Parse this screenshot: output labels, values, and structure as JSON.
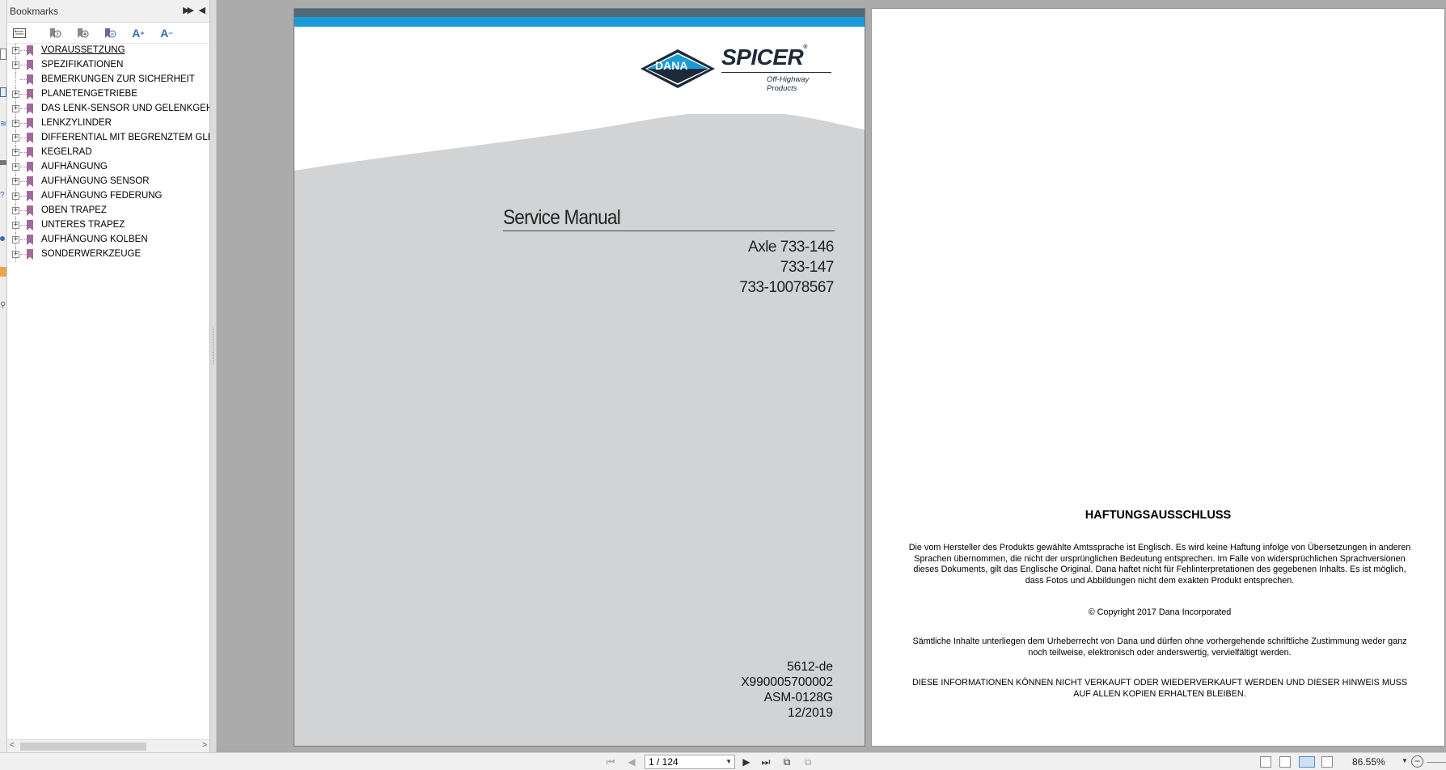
{
  "bookmarks": {
    "title": "Bookmarks",
    "items": [
      {
        "label": "VORAUSSETZUNG",
        "expandable": true
      },
      {
        "label": "SPEZIFIKATIONEN",
        "expandable": true
      },
      {
        "label": "BEMERKUNGEN ZUR SICHERHEIT",
        "expandable": false
      },
      {
        "label": "PLANETENGETRIEBE",
        "expandable": true
      },
      {
        "label": "DAS LENK-SENSOR UND GELENKGEHÄ",
        "expandable": true
      },
      {
        "label": "LENKZYLINDER",
        "expandable": true
      },
      {
        "label": "DIFFERENTIAL MIT BEGRENZTEM GLE",
        "expandable": true
      },
      {
        "label": "KEGELRAD",
        "expandable": true
      },
      {
        "label": "AUFHÄNGUNG",
        "expandable": true
      },
      {
        "label": "AUFHÄNGUNG SENSOR",
        "expandable": true
      },
      {
        "label": "AUFHÄNGUNG FEDERUNG",
        "expandable": true
      },
      {
        "label": "OBEN TRAPEZ",
        "expandable": true
      },
      {
        "label": "UNTERES TRAPEZ",
        "expandable": true
      },
      {
        "label": "AUFHÄNGUNG KOLBEN",
        "expandable": true
      },
      {
        "label": "SONDERWERKZEUGE",
        "expandable": true
      }
    ],
    "toolbar_icons": [
      "bookmark-options-icon",
      "expand-bookmark-icon",
      "add-bookmark-icon",
      "delete-bookmark-icon",
      "enlarge-text-icon",
      "reduce-text-icon"
    ],
    "enlarge_label": "A",
    "reduce_label": "A"
  },
  "cover": {
    "logo_dana": "DANA",
    "logo_spicer": "SPICER",
    "logo_reg": "®",
    "logo_sub": "Off-Highway Products",
    "title": "Service Manual",
    "axle_lines": [
      "Axle 733-146",
      "733-147",
      "733-10078567"
    ],
    "codes": [
      "5612-de",
      "X990005700002",
      "ASM-0128G",
      "12/2019"
    ],
    "colors": {
      "blue_bar": "#1a9bd7",
      "dark_bar": "#4f6a7a",
      "page_grey": "#d1d3d4",
      "dana_blue": "#1a9bd7",
      "dana_navy": "#1c2b39"
    }
  },
  "disclaimer": {
    "title": "HAFTUNGSAUSSCHLUSS",
    "paragraphs": [
      "Die vom Hersteller des Produkts gewählte Amtssprache ist Englisch. Es wird keine Haftung infolge von Übersetzungen in anderen Sprachen übernommen, die nicht der ursprünglichen Bedeutung entsprechen. Im Falle von widersprüchlichen Sprachversionen dieses Dokuments, gilt das Englische Original. Dana haftet nicht für Fehlinterpretationen des gegebenen Inhalts. Es ist möglich, dass Fotos und Abbildungen nicht dem exakten Produkt entsprechen.",
      "© Copyright 2017 Dana Incorporated",
      "Sämtliche Inhalte unterliegen dem Urheberrecht von Dana und dürfen ohne vorhergehende schriftliche Zustimmung weder ganz noch teilweise, elektronisch oder anderswertig, vervielfältigt werden.",
      "DIESE INFORMATIONEN KÖNNEN NICHT VERKAUFT ODER WIEDERVERKAUFT WERDEN UND DIESER HINWEIS MUSS AUF ALLEN KOPIEN ERHALTEN BLEIBEN."
    ]
  },
  "status": {
    "page_indicator": "1 / 124",
    "zoom": "86.55%"
  }
}
